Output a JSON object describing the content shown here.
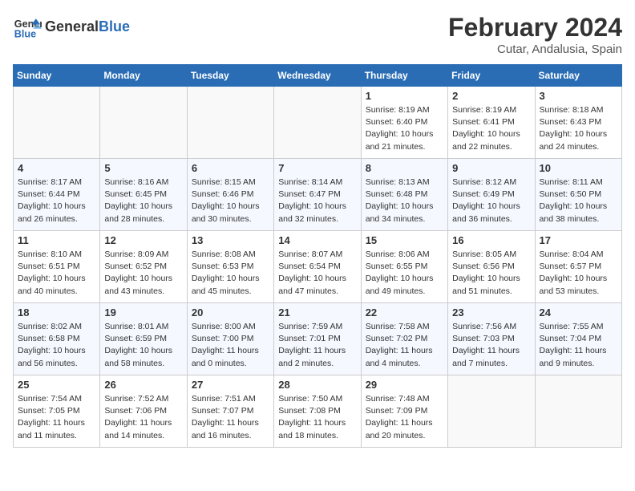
{
  "logo": {
    "line1": "General",
    "line2": "Blue"
  },
  "title": "February 2024",
  "location": "Cutar, Andalusia, Spain",
  "header": {
    "days": [
      "Sunday",
      "Monday",
      "Tuesday",
      "Wednesday",
      "Thursday",
      "Friday",
      "Saturday"
    ]
  },
  "weeks": [
    [
      {
        "day": "",
        "info": ""
      },
      {
        "day": "",
        "info": ""
      },
      {
        "day": "",
        "info": ""
      },
      {
        "day": "",
        "info": ""
      },
      {
        "day": "1",
        "info": "Sunrise: 8:19 AM\nSunset: 6:40 PM\nDaylight: 10 hours\nand 21 minutes."
      },
      {
        "day": "2",
        "info": "Sunrise: 8:19 AM\nSunset: 6:41 PM\nDaylight: 10 hours\nand 22 minutes."
      },
      {
        "day": "3",
        "info": "Sunrise: 8:18 AM\nSunset: 6:43 PM\nDaylight: 10 hours\nand 24 minutes."
      }
    ],
    [
      {
        "day": "4",
        "info": "Sunrise: 8:17 AM\nSunset: 6:44 PM\nDaylight: 10 hours\nand 26 minutes."
      },
      {
        "day": "5",
        "info": "Sunrise: 8:16 AM\nSunset: 6:45 PM\nDaylight: 10 hours\nand 28 minutes."
      },
      {
        "day": "6",
        "info": "Sunrise: 8:15 AM\nSunset: 6:46 PM\nDaylight: 10 hours\nand 30 minutes."
      },
      {
        "day": "7",
        "info": "Sunrise: 8:14 AM\nSunset: 6:47 PM\nDaylight: 10 hours\nand 32 minutes."
      },
      {
        "day": "8",
        "info": "Sunrise: 8:13 AM\nSunset: 6:48 PM\nDaylight: 10 hours\nand 34 minutes."
      },
      {
        "day": "9",
        "info": "Sunrise: 8:12 AM\nSunset: 6:49 PM\nDaylight: 10 hours\nand 36 minutes."
      },
      {
        "day": "10",
        "info": "Sunrise: 8:11 AM\nSunset: 6:50 PM\nDaylight: 10 hours\nand 38 minutes."
      }
    ],
    [
      {
        "day": "11",
        "info": "Sunrise: 8:10 AM\nSunset: 6:51 PM\nDaylight: 10 hours\nand 40 minutes."
      },
      {
        "day": "12",
        "info": "Sunrise: 8:09 AM\nSunset: 6:52 PM\nDaylight: 10 hours\nand 43 minutes."
      },
      {
        "day": "13",
        "info": "Sunrise: 8:08 AM\nSunset: 6:53 PM\nDaylight: 10 hours\nand 45 minutes."
      },
      {
        "day": "14",
        "info": "Sunrise: 8:07 AM\nSunset: 6:54 PM\nDaylight: 10 hours\nand 47 minutes."
      },
      {
        "day": "15",
        "info": "Sunrise: 8:06 AM\nSunset: 6:55 PM\nDaylight: 10 hours\nand 49 minutes."
      },
      {
        "day": "16",
        "info": "Sunrise: 8:05 AM\nSunset: 6:56 PM\nDaylight: 10 hours\nand 51 minutes."
      },
      {
        "day": "17",
        "info": "Sunrise: 8:04 AM\nSunset: 6:57 PM\nDaylight: 10 hours\nand 53 minutes."
      }
    ],
    [
      {
        "day": "18",
        "info": "Sunrise: 8:02 AM\nSunset: 6:58 PM\nDaylight: 10 hours\nand 56 minutes."
      },
      {
        "day": "19",
        "info": "Sunrise: 8:01 AM\nSunset: 6:59 PM\nDaylight: 10 hours\nand 58 minutes."
      },
      {
        "day": "20",
        "info": "Sunrise: 8:00 AM\nSunset: 7:00 PM\nDaylight: 11 hours\nand 0 minutes."
      },
      {
        "day": "21",
        "info": "Sunrise: 7:59 AM\nSunset: 7:01 PM\nDaylight: 11 hours\nand 2 minutes."
      },
      {
        "day": "22",
        "info": "Sunrise: 7:58 AM\nSunset: 7:02 PM\nDaylight: 11 hours\nand 4 minutes."
      },
      {
        "day": "23",
        "info": "Sunrise: 7:56 AM\nSunset: 7:03 PM\nDaylight: 11 hours\nand 7 minutes."
      },
      {
        "day": "24",
        "info": "Sunrise: 7:55 AM\nSunset: 7:04 PM\nDaylight: 11 hours\nand 9 minutes."
      }
    ],
    [
      {
        "day": "25",
        "info": "Sunrise: 7:54 AM\nSunset: 7:05 PM\nDaylight: 11 hours\nand 11 minutes."
      },
      {
        "day": "26",
        "info": "Sunrise: 7:52 AM\nSunset: 7:06 PM\nDaylight: 11 hours\nand 14 minutes."
      },
      {
        "day": "27",
        "info": "Sunrise: 7:51 AM\nSunset: 7:07 PM\nDaylight: 11 hours\nand 16 minutes."
      },
      {
        "day": "28",
        "info": "Sunrise: 7:50 AM\nSunset: 7:08 PM\nDaylight: 11 hours\nand 18 minutes."
      },
      {
        "day": "29",
        "info": "Sunrise: 7:48 AM\nSunset: 7:09 PM\nDaylight: 11 hours\nand 20 minutes."
      },
      {
        "day": "",
        "info": ""
      },
      {
        "day": "",
        "info": ""
      }
    ]
  ]
}
